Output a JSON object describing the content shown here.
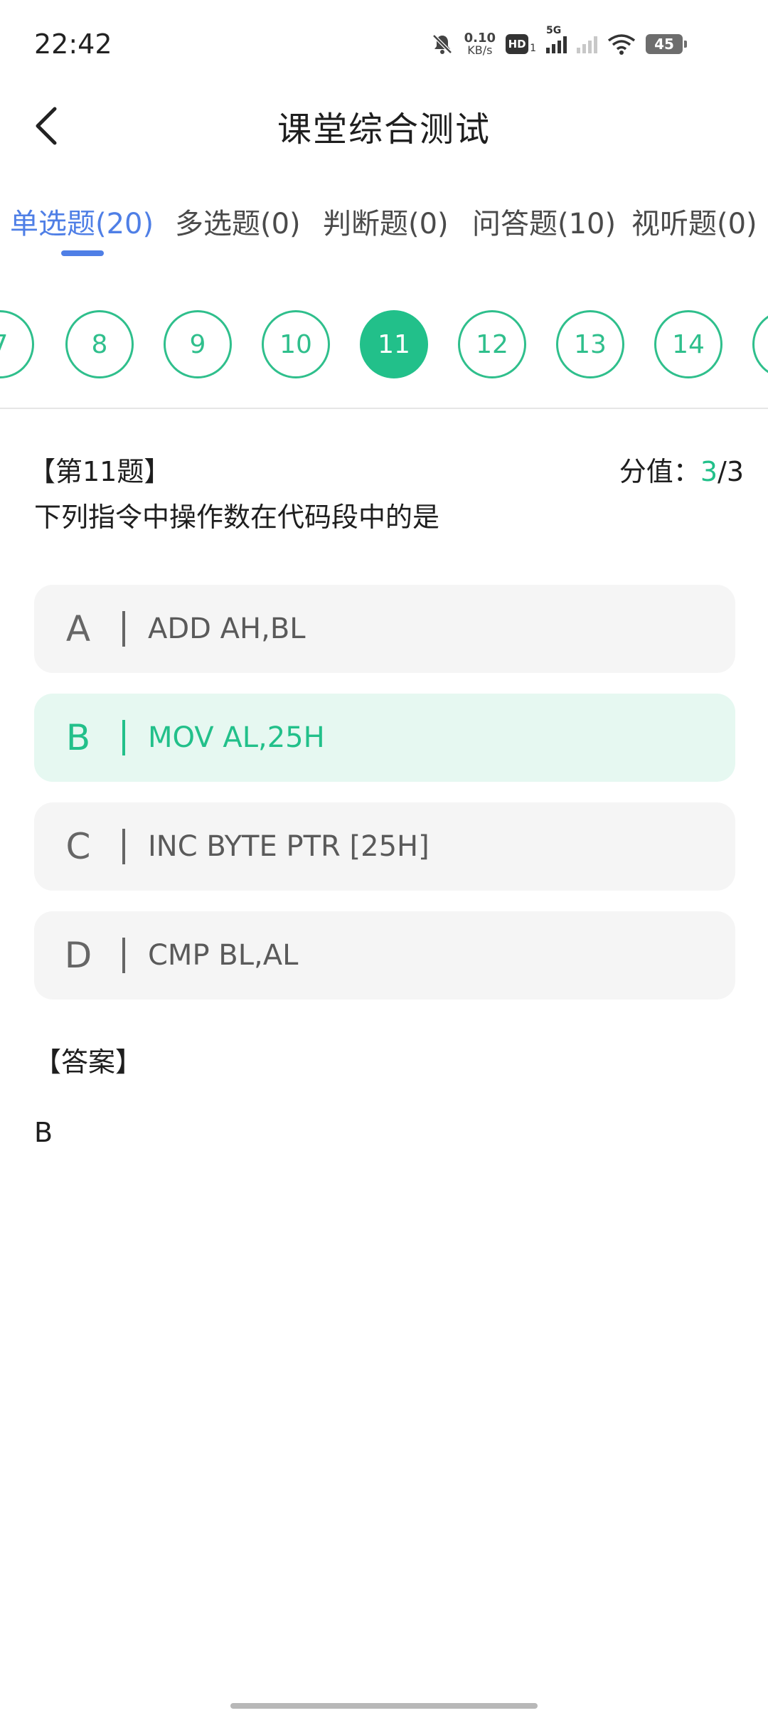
{
  "status_bar": {
    "time": "22:42",
    "speed_value": "0.10",
    "speed_unit": "KB/s",
    "hd_label": "HD",
    "hd_sub": "1",
    "network": "5G",
    "battery": "45",
    "icons": [
      "bell-muted-icon",
      "hd-icon",
      "signal-5g-icon",
      "signal-icon",
      "wifi-icon",
      "battery-icon"
    ]
  },
  "header": {
    "title": "课堂综合测试",
    "back_icon": "chevron-left-icon"
  },
  "tabs": [
    {
      "label": "单选题(20)",
      "active": true
    },
    {
      "label": "多选题(0)",
      "active": false
    },
    {
      "label": "判断题(0)",
      "active": false
    },
    {
      "label": "问答题(10)",
      "active": false
    },
    {
      "label": "视听题(0)",
      "active": false
    }
  ],
  "question_numbers": [
    "7",
    "8",
    "9",
    "10",
    "11",
    "12",
    "13",
    "14",
    ""
  ],
  "current_question": "11",
  "question": {
    "label": "【第11题】",
    "score_label": "分值：",
    "score_got": "3",
    "score_sep": "/",
    "score_total": "3",
    "text": "下列指令中操作数在代码段中的是"
  },
  "options": [
    {
      "key": "A",
      "text": "ADD AH,BL",
      "selected": false
    },
    {
      "key": "B",
      "text": "MOV AL,25H",
      "selected": true
    },
    {
      "key": "C",
      "text": "INC BYTE PTR [25H]",
      "selected": false
    },
    {
      "key": "D",
      "text": "CMP BL,AL",
      "selected": false
    }
  ],
  "answer": {
    "label": "【答案】",
    "value": "B"
  },
  "colors": {
    "accent_green": "#22c08a",
    "tab_blue": "#4f7fe6",
    "option_bg": "#f5f5f5",
    "option_selected_bg": "#e6f8f1"
  }
}
